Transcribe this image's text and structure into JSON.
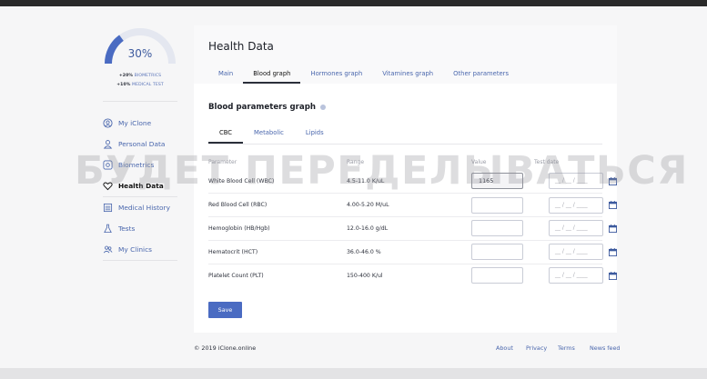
{
  "progress": {
    "percent": 30,
    "label": "30%"
  },
  "stats": [
    {
      "value": "+20%",
      "label": "BIOMETRICS"
    },
    {
      "value": "+10%",
      "label": "MEDICAL TEST"
    }
  ],
  "sidebar": {
    "items": [
      {
        "label": "My iClone",
        "icon": "user-icon"
      },
      {
        "label": "Personal Data",
        "icon": "user-outline-icon"
      },
      {
        "label": "Biometrics",
        "icon": "eye-icon"
      },
      {
        "label": "Health Data",
        "icon": "heart-icon",
        "active": true
      },
      {
        "label": "Medical History",
        "icon": "calendar-icon"
      },
      {
        "label": "Tests",
        "icon": "flask-icon"
      },
      {
        "label": "My Clinics",
        "icon": "users-icon"
      }
    ]
  },
  "card": {
    "title": "Health Data",
    "tabs": [
      "Main",
      "Blood graph",
      "Hormones graph",
      "Vitamines graph",
      "Other parameters"
    ],
    "active_tab": "Blood graph",
    "section_title": "Blood parameters graph",
    "subtabs": [
      "CBC",
      "Metabolic",
      "Lipids"
    ],
    "active_subtab": "CBC",
    "columns": {
      "parameter": "Parameter",
      "range": "Range",
      "value": "Value",
      "date": "Test date"
    },
    "rows": [
      {
        "parameter": "White Blood Cell (WBC)",
        "range": "4.5-11.0 K/uL",
        "value": "1165"
      },
      {
        "parameter": "Red Blood Cell (RBC)",
        "range": "4.00-5.20 M/uL",
        "value": ""
      },
      {
        "parameter": "Hemoglobin (HB/Hgb)",
        "range": "12.0-16.0 g/dL",
        "value": ""
      },
      {
        "parameter": "Hematocrit (HCT)",
        "range": "36.0-46.0 %",
        "value": ""
      },
      {
        "parameter": "Platelet Count (PLT)",
        "range": "150-400 K/ul",
        "value": ""
      }
    ],
    "date_placeholder": "__ / __ / ____",
    "save_label": "Save"
  },
  "watermark": "БУДЕТ ПЕРЕДЕЛЫВАТЬСЯ",
  "footer": {
    "copyright": "© 2019 iClone.online",
    "links": [
      "About",
      "Privacy",
      "Terms",
      "News feed"
    ]
  },
  "colors": {
    "accent": "#4a6bc2",
    "link": "#4a67ad",
    "progress_track": "#e4e7f0"
  }
}
